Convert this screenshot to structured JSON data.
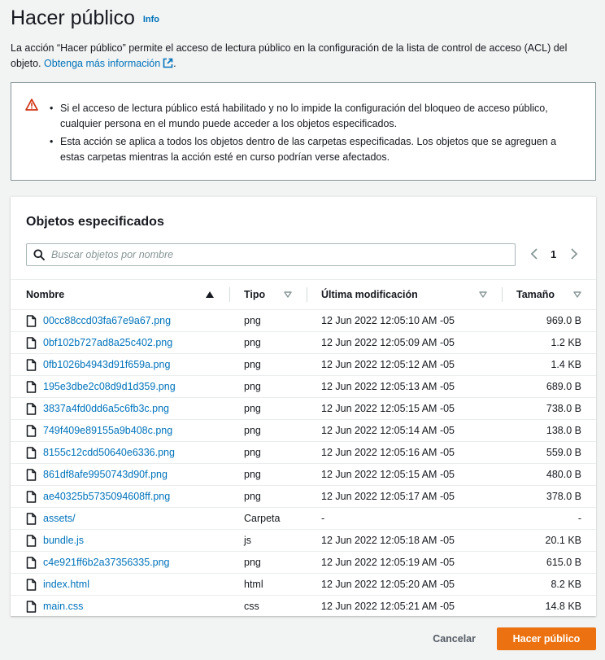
{
  "header": {
    "title": "Hacer público",
    "info_label": "Info"
  },
  "description": {
    "text": "La acción “Hacer público” permite el acceso de lectura público en la configuración de la lista de control de acceso (ACL) del objeto.",
    "link_label": "Obtenga más información"
  },
  "alert": {
    "icon": "warning-triangle-icon",
    "bullets": [
      "Si el acceso de lectura público está habilitado y no lo impide la configuración del bloqueo de acceso público, cualquier persona en el mundo puede acceder a los objetos especificados.",
      "Esta acción se aplica a todos los objetos dentro de las carpetas especificadas. Los objetos que se agreguen a estas carpetas mientras la acción esté en curso podrían verse afectados."
    ]
  },
  "panel": {
    "title": "Objetos especificados",
    "search_placeholder": "Buscar objetos por nombre",
    "page_number": "1",
    "columns": {
      "name": "Nombre",
      "type": "Tipo",
      "modified": "Última modificación",
      "size": "Tamaño"
    },
    "rows": [
      {
        "name": "00cc88ccd03fa67e9a67.png",
        "type": "png",
        "modified": "12 Jun 2022 12:05:10 AM -05",
        "size": "969.0 B",
        "icon": "file-icon"
      },
      {
        "name": "0bf102b727ad8a25c402.png",
        "type": "png",
        "modified": "12 Jun 2022 12:05:09 AM -05",
        "size": "1.2 KB",
        "icon": "file-icon"
      },
      {
        "name": "0fb1026b4943d91f659a.png",
        "type": "png",
        "modified": "12 Jun 2022 12:05:12 AM -05",
        "size": "1.4 KB",
        "icon": "file-icon"
      },
      {
        "name": "195e3dbe2c08d9d1d359.png",
        "type": "png",
        "modified": "12 Jun 2022 12:05:13 AM -05",
        "size": "689.0 B",
        "icon": "file-icon"
      },
      {
        "name": "3837a4fd0dd6a5c6fb3c.png",
        "type": "png",
        "modified": "12 Jun 2022 12:05:15 AM -05",
        "size": "738.0 B",
        "icon": "file-icon"
      },
      {
        "name": "749f409e89155a9b408c.png",
        "type": "png",
        "modified": "12 Jun 2022 12:05:14 AM -05",
        "size": "138.0 B",
        "icon": "file-icon"
      },
      {
        "name": "8155c12cdd50640e6336.png",
        "type": "png",
        "modified": "12 Jun 2022 12:05:16 AM -05",
        "size": "559.0 B",
        "icon": "file-icon"
      },
      {
        "name": "861df8afe9950743d90f.png",
        "type": "png",
        "modified": "12 Jun 2022 12:05:15 AM -05",
        "size": "480.0 B",
        "icon": "file-icon"
      },
      {
        "name": "ae40325b5735094608ff.png",
        "type": "png",
        "modified": "12 Jun 2022 12:05:17 AM -05",
        "size": "378.0 B",
        "icon": "file-icon"
      },
      {
        "name": "assets/",
        "type": "Carpeta",
        "modified": "-",
        "size": "-",
        "icon": "folder-icon"
      },
      {
        "name": "bundle.js",
        "type": "js",
        "modified": "12 Jun 2022 12:05:18 AM -05",
        "size": "20.1 KB",
        "icon": "file-icon"
      },
      {
        "name": "c4e921ff6b2a37356335.png",
        "type": "png",
        "modified": "12 Jun 2022 12:05:19 AM -05",
        "size": "615.0 B",
        "icon": "file-icon"
      },
      {
        "name": "index.html",
        "type": "html",
        "modified": "12 Jun 2022 12:05:20 AM -05",
        "size": "8.2 KB",
        "icon": "file-icon"
      },
      {
        "name": "main.css",
        "type": "css",
        "modified": "12 Jun 2022 12:05:21 AM -05",
        "size": "14.8 KB",
        "icon": "file-icon"
      }
    ]
  },
  "footer": {
    "cancel_label": "Cancelar",
    "submit_label": "Hacer público"
  },
  "colors": {
    "link": "#0073bb",
    "primary": "#ec7211",
    "warning": "#d13212"
  }
}
